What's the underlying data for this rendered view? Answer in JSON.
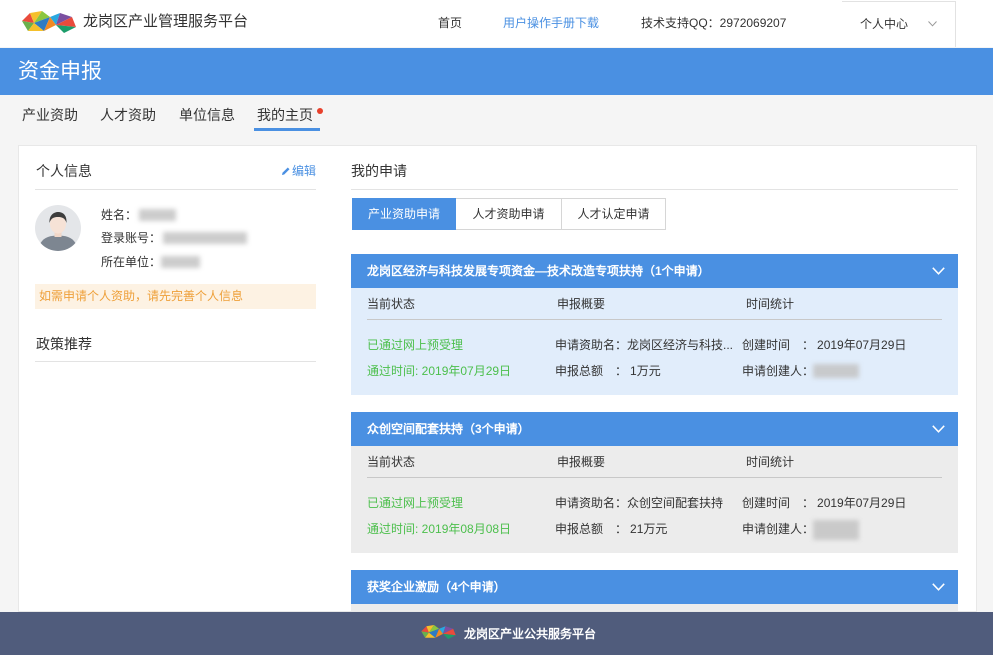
{
  "header": {
    "title": "龙岗区产业管理服务平台",
    "nav_home": "首页",
    "nav_manual": "用户操作手册下载",
    "nav_support": "技术支持QQ：2972069207",
    "user_menu": "个人中心"
  },
  "banner": {
    "title": "资金申报"
  },
  "tabs": [
    {
      "label": "产业资助"
    },
    {
      "label": "人才资助"
    },
    {
      "label": "单位信息"
    },
    {
      "label": "我的主页",
      "active": true,
      "has_badge_dot": true
    }
  ],
  "profile": {
    "heading": "个人信息",
    "edit_label": "编辑",
    "name_label": "姓名：",
    "account_label": "登录账号：",
    "unit_label": "所在单位：",
    "notice": "如需申请个人资助，请先完善个人信息",
    "policy_heading": "政策推荐"
  },
  "applications": {
    "heading": "我的申请",
    "filters": [
      {
        "label": "产业资助申请",
        "active": true
      },
      {
        "label": "人才资助申请"
      },
      {
        "label": "人才认定申请"
      }
    ],
    "columns": {
      "status": "当前状态",
      "summary": "申报概要",
      "time": "时间统计"
    },
    "labels": {
      "fund_name": "申请资助名：",
      "amount": "申报总额　：",
      "created_time": "创建时间　：",
      "creator": "申请创建人："
    },
    "groups": [
      {
        "title": "龙岗区经济与科技发展专项资金—技术改造专项扶持（1个申请）",
        "expanded": true,
        "highlighted": true,
        "status": "已通过网上预受理",
        "pass_time": "通过时间: 2019年07月29日",
        "fund_name": "龙岗区经济与科技...",
        "amount": "1万元",
        "created_time": "2019年07月29日"
      },
      {
        "title": "众创空间配套扶持（3个申请）",
        "expanded": true,
        "status": "已通过网上预受理",
        "pass_time": "通过时间: 2019年08月08日",
        "fund_name": "众创空间配套扶持",
        "amount": "21万元",
        "created_time": "2019年07月29日"
      },
      {
        "title": "获奖企业激励（4个申请）"
      }
    ]
  },
  "footer": {
    "text": "龙岗区产业公共服务平台"
  },
  "icons": [
    "platform-logo",
    "chevron-down-icon",
    "pencil-icon",
    "avatar-icon",
    "footer-logo"
  ],
  "colors": {
    "primary": "#4a90e2",
    "status_green": "#4cbf4c",
    "notice_text": "#eea03a",
    "notice_bg": "#fdf2e3",
    "footer_bg": "#505c7c",
    "badge_red": "#e8412c",
    "highlight_bg": "#e1edfb",
    "panel_gray_bg": "#ececec"
  }
}
